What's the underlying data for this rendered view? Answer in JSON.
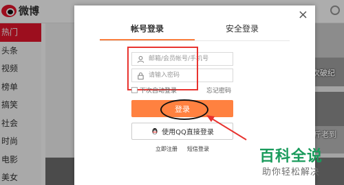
{
  "background": {
    "logo_text": "微博",
    "sidebar_items": [
      "热门",
      "头条",
      "视频",
      "榜单",
      "搞笑",
      "社会",
      "时尚",
      "电影",
      "美女"
    ],
    "snippets": [
      "次破纪",
      "斤老到"
    ]
  },
  "login": {
    "close_glyph": "×",
    "tabs": [
      {
        "label": "帐号登录",
        "active": true
      },
      {
        "label": "安全登录",
        "active": false
      }
    ],
    "username_placeholder": "邮箱/会员帐号/手机号",
    "password_placeholder": "请输入密码",
    "remember_label": "下次自动登录",
    "forgot_label": "忘记密码",
    "login_button": "登录",
    "qq_button": "使用QQ直接登录",
    "register_link": "立即注册",
    "sms_link": "短信登录"
  },
  "watermark": {
    "title": "百科全说",
    "subtitle": "助你轻松解决"
  },
  "colors": {
    "accent_orange": "#ff8140",
    "brand_red": "#e6162d",
    "annotation_red": "#e8322e",
    "watermark_green": "#1a9b5c"
  },
  "icons": {
    "user": "user-icon",
    "lock": "lock-icon",
    "qq": "qq-icon",
    "close": "close-icon"
  }
}
